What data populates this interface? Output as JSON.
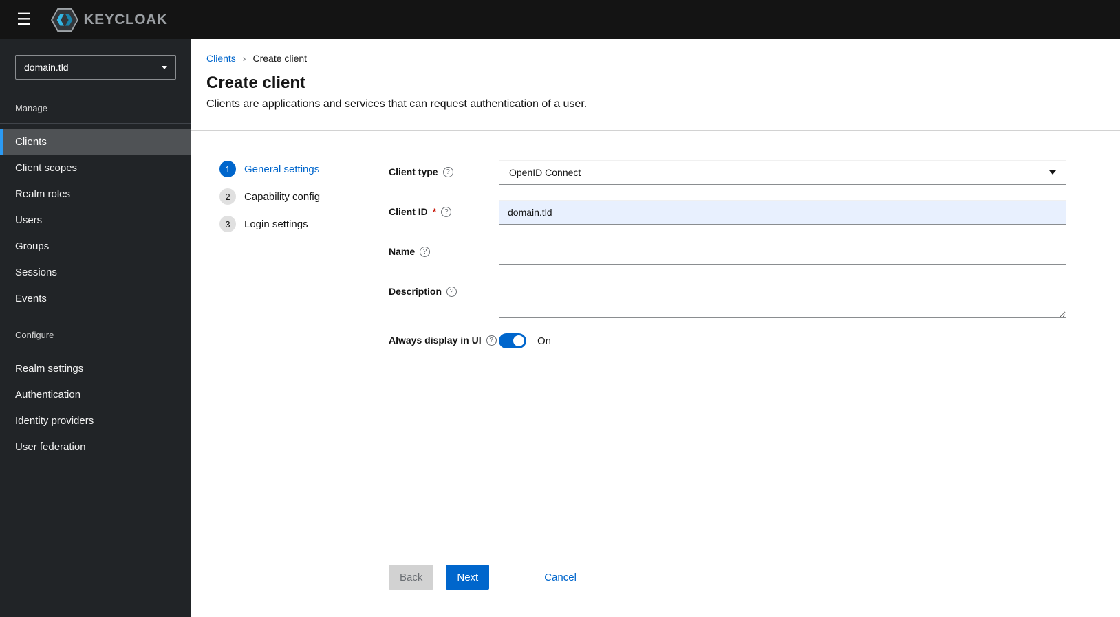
{
  "icons": {
    "hamburger": "☰",
    "help": "?",
    "breadcrumb_separator": "›"
  },
  "header": {
    "logo_text": "KEYCLOAK"
  },
  "sidebar": {
    "realm_selector": {
      "value": "domain.tld"
    },
    "sections": [
      {
        "label": "Manage",
        "items": [
          {
            "label": "Clients",
            "selected": true
          },
          {
            "label": "Client scopes"
          },
          {
            "label": "Realm roles"
          },
          {
            "label": "Users"
          },
          {
            "label": "Groups"
          },
          {
            "label": "Sessions"
          },
          {
            "label": "Events"
          }
        ]
      },
      {
        "label": "Configure",
        "items": [
          {
            "label": "Realm settings"
          },
          {
            "label": "Authentication"
          },
          {
            "label": "Identity providers"
          },
          {
            "label": "User federation"
          }
        ]
      }
    ]
  },
  "breadcrumb": {
    "items": [
      "Clients",
      "Create client"
    ]
  },
  "page": {
    "title": "Create client",
    "subtitle": "Clients are applications and services that can request authentication of a user."
  },
  "wizard": {
    "steps": [
      {
        "number": "1",
        "label": "General settings",
        "active": true
      },
      {
        "number": "2",
        "label": "Capability config",
        "active": false
      },
      {
        "number": "3",
        "label": "Login settings",
        "active": false
      }
    ]
  },
  "form": {
    "client_type": {
      "label": "Client type",
      "value": "OpenID Connect"
    },
    "client_id": {
      "label": "Client ID",
      "required_marker": "*",
      "value": "domain.tld"
    },
    "name": {
      "label": "Name",
      "value": ""
    },
    "description": {
      "label": "Description",
      "value": ""
    },
    "always_display": {
      "label": "Always display in UI",
      "state_label": "On"
    }
  },
  "footer": {
    "back_label": "Back",
    "next_label": "Next",
    "cancel_label": "Cancel"
  },
  "colors": {
    "accent": "#0066cc",
    "link": "#0066cc",
    "required": "#c9190b",
    "header_bg": "#141414",
    "sidebar_bg": "#212427",
    "sidebar_selected_bg": "#4f5255",
    "sidebar_selected_border": "#2b9af3",
    "toggle_on": "#0066cc",
    "client_id_field_bg": "#e8f0fe"
  }
}
